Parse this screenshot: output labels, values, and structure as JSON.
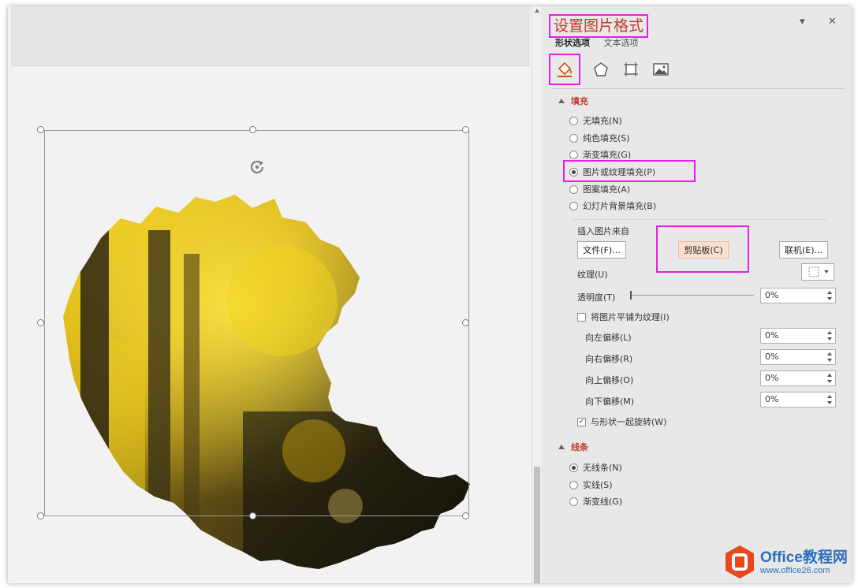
{
  "pane": {
    "title": "设置图片格式",
    "tabs": [
      {
        "label": "形状选项"
      },
      {
        "label": "文本选项"
      }
    ],
    "fill_section": {
      "header": "填充",
      "options": [
        {
          "label": "无填充(N)",
          "selected": false
        },
        {
          "label": "纯色填充(S)",
          "selected": false
        },
        {
          "label": "渐变填充(G)",
          "selected": false
        },
        {
          "label": "图片或纹理填充(P)",
          "selected": true
        },
        {
          "label": "图案填充(A)",
          "selected": false
        },
        {
          "label": "幻灯片背景填充(B)",
          "selected": false
        }
      ],
      "insert_from_label": "插入图片来自",
      "file_button": "文件(F)...",
      "clipboard_button": "剪贴板(C)",
      "online_button": "联机(E)...",
      "texture_label": "纹理(U)",
      "transparency_label": "透明度(T)",
      "transparency_value": "0%",
      "tile_label": "将图片平铺为纹理(I)",
      "tile_checked": false,
      "offsets": [
        {
          "label": "向左偏移(L)",
          "value": "0%"
        },
        {
          "label": "向右偏移(R)",
          "value": "0%"
        },
        {
          "label": "向上偏移(O)",
          "value": "0%"
        },
        {
          "label": "向下偏移(M)",
          "value": "0%"
        }
      ],
      "rotate_label": "与形状一起旋转(W)",
      "rotate_checked": true
    },
    "line_section": {
      "header": "线条",
      "options": [
        {
          "label": "无线条(N)",
          "selected": true
        },
        {
          "label": "实线(S)",
          "selected": false
        },
        {
          "label": "渐变线(G)",
          "selected": false
        }
      ]
    }
  },
  "watermark": {
    "name": "Office教程网",
    "url": "www.office26.com"
  },
  "colors": {
    "accent_red": "#c0392b",
    "highlight_magenta": "#e81ee8",
    "peach_button": "#fbe0d0"
  }
}
